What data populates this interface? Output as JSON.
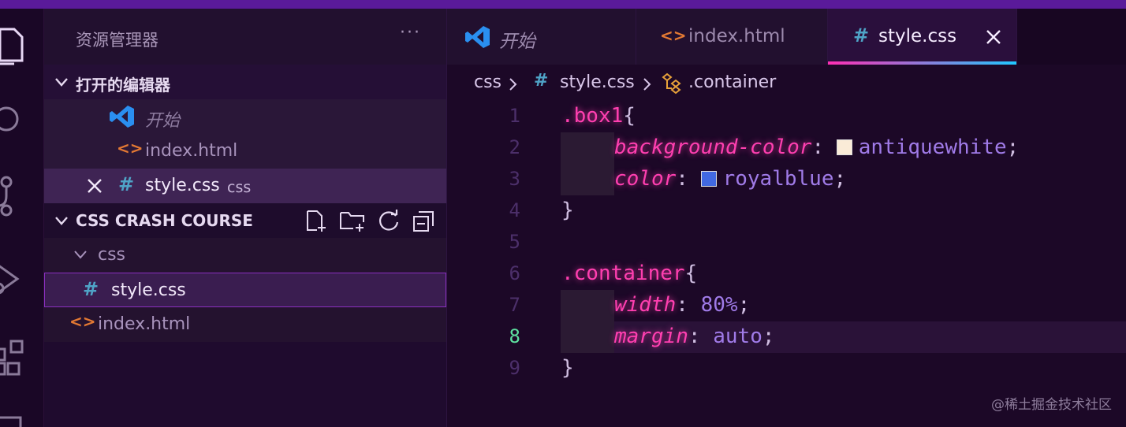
{
  "sidebar": {
    "title": "资源管理器",
    "more": "···",
    "open_editors": {
      "label": "打开的编辑器",
      "items": [
        {
          "label": "开始",
          "icon": "vscode-logo-icon"
        },
        {
          "label": "index.html",
          "icon": "html-file-icon"
        },
        {
          "label": "style.css",
          "folder": "css",
          "icon": "css-file-icon"
        }
      ]
    },
    "project": {
      "label": "CSS CRASH COURSE",
      "folder": "css",
      "items": [
        {
          "label": "style.css",
          "icon": "css-file-icon"
        },
        {
          "label": "index.html",
          "icon": "html-file-icon"
        }
      ]
    }
  },
  "tabs": [
    {
      "label": "开始",
      "icon": "vscode-logo-icon"
    },
    {
      "label": "index.html",
      "icon": "html-file-icon"
    },
    {
      "label": "style.css",
      "icon": "css-file-icon",
      "active": true
    }
  ],
  "breadcrumb": {
    "folder": "css",
    "file": "style.css",
    "symbol": ".container"
  },
  "code": {
    "line_numbers": [
      "1",
      "2",
      "3",
      "4",
      "5",
      "6",
      "7",
      "8",
      "9"
    ],
    "current_line": 8,
    "lines": [
      {
        "sel": ".box1",
        "open": "{"
      },
      {
        "prop": "background-color",
        "colon": ":",
        "swatch": "#faebd7",
        "val": "antiquewhite",
        "semi": ";"
      },
      {
        "prop": "color",
        "colon": ":",
        "swatch": "#4169e1",
        "val": "royalblue",
        "semi": ";"
      },
      {
        "close": "}"
      },
      {},
      {
        "sel": ".container",
        "open": "{"
      },
      {
        "prop": "width",
        "colon": ":",
        "val": "80%",
        "semi": ";"
      },
      {
        "prop": "margin",
        "colon": ":",
        "val": "auto",
        "semi": ";"
      },
      {
        "close": "}"
      }
    ]
  },
  "watermark": "@稀土掘金技术社区",
  "colors": {
    "accent_pink": "#ff3fb0",
    "accent_cyan": "#20c8ff",
    "value_purple": "#a07be8",
    "current_line_number": "#5ee0a0"
  }
}
